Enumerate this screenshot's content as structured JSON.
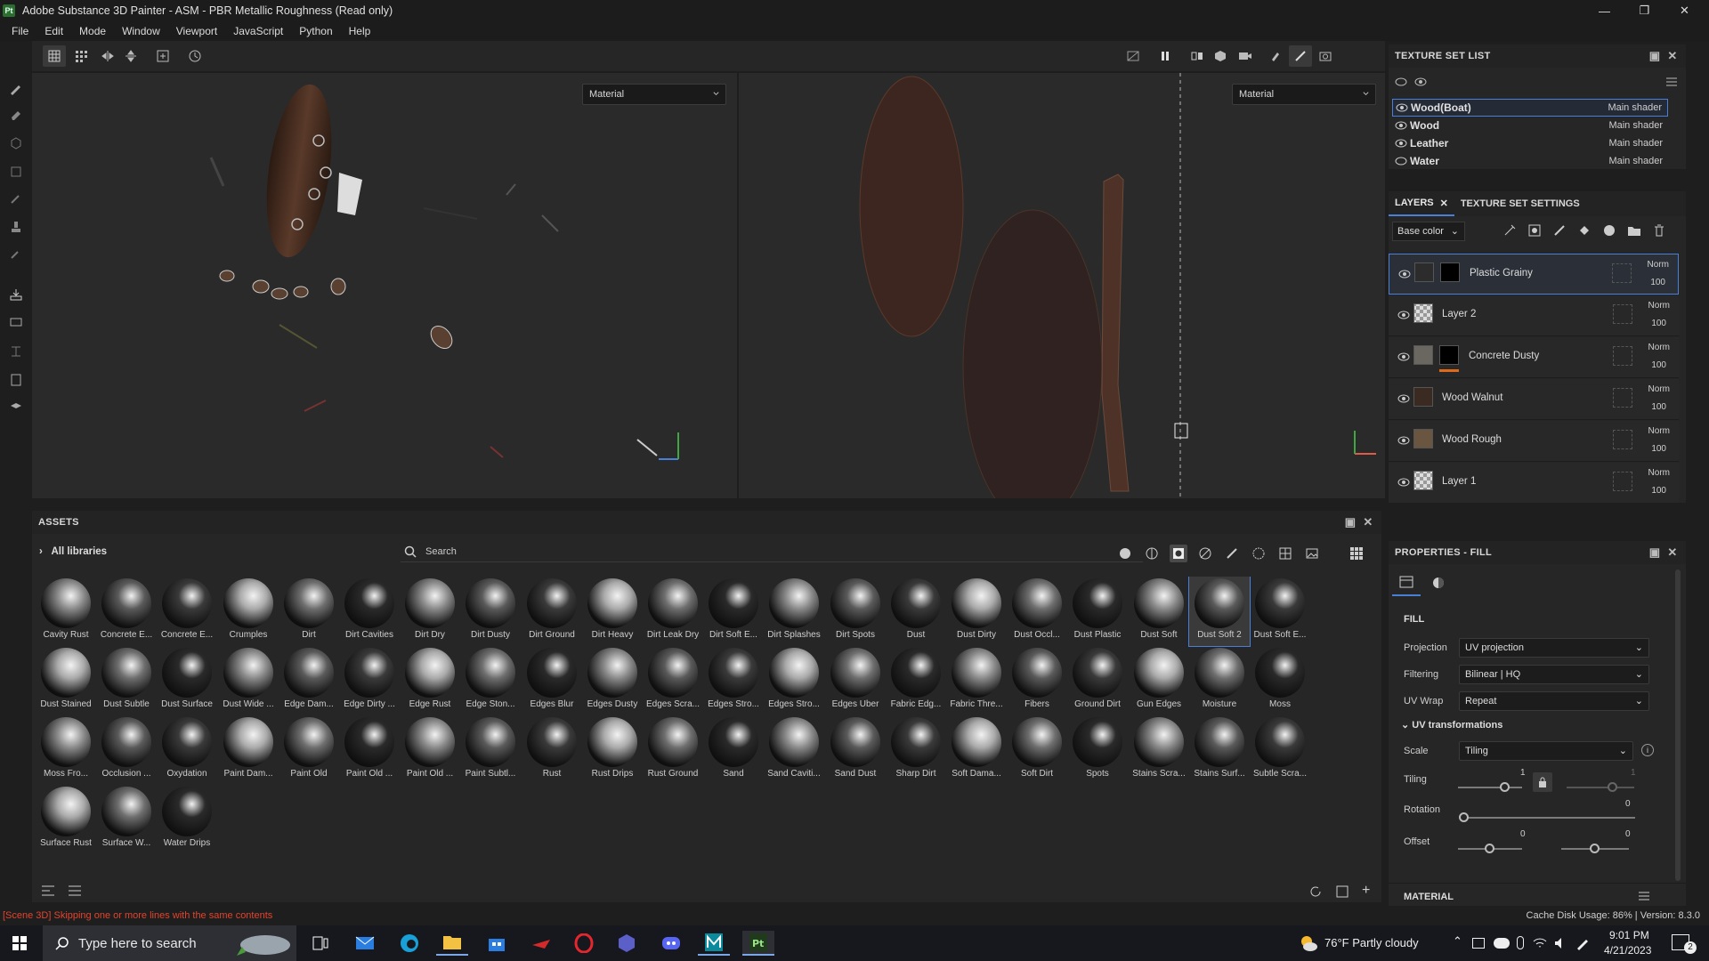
{
  "window": {
    "title": "Adobe Substance 3D Painter - ASM - PBR Metallic Roughness (Read only)",
    "app_icon": "Pt"
  },
  "menu": [
    "File",
    "Edit",
    "Mode",
    "Window",
    "Viewport",
    "JavaScript",
    "Python",
    "Help"
  ],
  "viewport3d": {
    "channel": "Material"
  },
  "viewport2d": {
    "channel": "Material"
  },
  "texture_set_list": {
    "title": "TEXTURE SET LIST",
    "items": [
      {
        "name": "Wood(Boat)",
        "shader": "Main shader"
      },
      {
        "name": "Wood",
        "shader": "Main shader"
      },
      {
        "name": "Leather",
        "shader": "Main shader"
      },
      {
        "name": "Water",
        "shader": "Main shader"
      }
    ]
  },
  "layers": {
    "tab_layers": "LAYERS",
    "tab_settings": "TEXTURE SET SETTINGS",
    "channel": "Base color",
    "items": [
      {
        "name": "Plastic Grainy",
        "blend": "Norm",
        "opacity": "100",
        "thumb": "#2c2c2c"
      },
      {
        "name": "Layer 2",
        "blend": "Norm",
        "opacity": "100",
        "thumb": "checker"
      },
      {
        "name": "Concrete Dusty",
        "blend": "Norm",
        "opacity": "100",
        "thumb": "#6a6660",
        "accent": "#e06a1a"
      },
      {
        "name": "Wood Walnut",
        "blend": "Norm",
        "opacity": "100",
        "thumb": "#3a2a22"
      },
      {
        "name": "Wood Rough",
        "blend": "Norm",
        "opacity": "100",
        "thumb": "#6a5540"
      },
      {
        "name": "Layer 1",
        "blend": "Norm",
        "opacity": "100",
        "thumb": "checker"
      }
    ]
  },
  "assets": {
    "title": "ASSETS",
    "library": "All libraries",
    "search_placeholder": "Search",
    "items": [
      "Cavity Rust",
      "Concrete E...",
      "Concrete E...",
      "Crumples",
      "Dirt",
      "Dirt Cavities",
      "Dirt Dry",
      "Dirt Dusty",
      "Dirt Ground",
      "Dirt Heavy",
      "Dirt Leak Dry",
      "Dirt Soft E...",
      "Dirt Splashes",
      "Dirt Spots",
      "Dust",
      "Dust Dirty",
      "Dust Occl...",
      "Dust Plastic",
      "Dust Soft",
      "Dust Soft 2",
      "Dust Soft E...",
      "Dust Stained",
      "Dust Subtle",
      "Dust Surface",
      "Dust Wide ...",
      "Edge Dam...",
      "Edge Dirty ...",
      "Edge Rust",
      "Edge Ston...",
      "Edges Blur",
      "Edges Dusty",
      "Edges Scra...",
      "Edges Stro...",
      "Edges Stro...",
      "Edges Uber",
      "Fabric Edg...",
      "Fabric Thre...",
      "Fibers",
      "Ground Dirt",
      "Gun Edges",
      "Moisture",
      "Moss",
      "Moss Fro...",
      "Occlusion ...",
      "Oxydation",
      "Paint Dam...",
      "Paint Old",
      "Paint Old ...",
      "Paint Old ...",
      "Paint Subtl...",
      "Rust",
      "Rust Drips",
      "Rust Ground",
      "Sand",
      "Sand Caviti...",
      "Sand Dust",
      "Sharp Dirt",
      "Soft Dama...",
      "Soft Dirt",
      "Spots",
      "Stains Scra...",
      "Stains Surf...",
      "Subtle Scra...",
      "Surface Rust",
      "Surface W...",
      "Water Drips"
    ],
    "selected_index": 19
  },
  "properties": {
    "title": "PROPERTIES - FILL",
    "section_fill": "FILL",
    "projection_label": "Projection",
    "projection_value": "UV projection",
    "filtering_label": "Filtering",
    "filtering_value": "Bilinear | HQ",
    "uvwrap_label": "UV Wrap",
    "uvwrap_value": "Repeat",
    "uv_transform_label": "UV transformations",
    "scale_label": "Scale",
    "scale_value": "Tiling",
    "tiling_label": "Tiling",
    "tiling_value": "1",
    "tiling_value2": "1",
    "rotation_label": "Rotation",
    "rotation_value": "0",
    "offset_label": "Offset",
    "offset_value": "0",
    "offset_value2": "0",
    "section_material": "MATERIAL"
  },
  "status": {
    "message": "[Scene 3D] Skipping one or more lines with the same contents",
    "cache": "Cache Disk Usage:   86% | Version: 8.3.0"
  },
  "taskbar": {
    "search_placeholder": "Type here to search",
    "weather": "76°F  Partly cloudy",
    "time": "9:01 PM",
    "date": "4/21/2023",
    "notifications": "2"
  }
}
